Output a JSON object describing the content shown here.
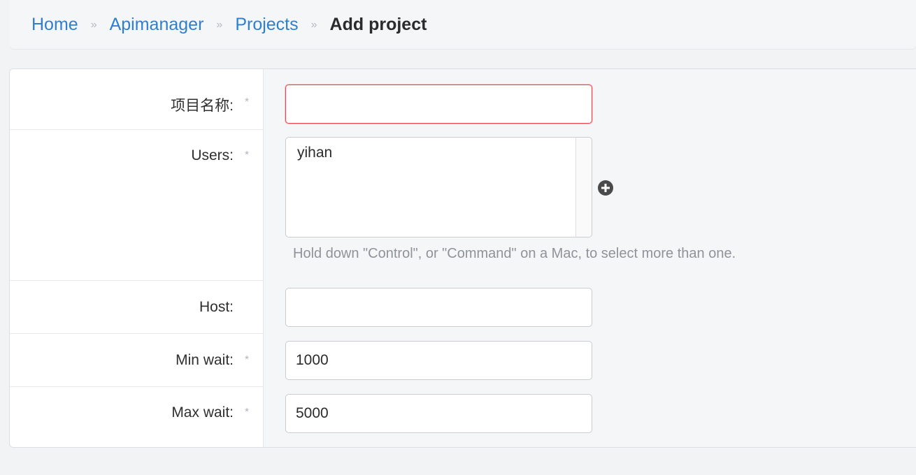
{
  "breadcrumb": {
    "home": "Home",
    "app": "Apimanager",
    "model": "Projects",
    "current": "Add project",
    "separator": "»"
  },
  "form": {
    "name": {
      "label": "项目名称:",
      "required": "*",
      "value": ""
    },
    "users": {
      "label": "Users:",
      "required": "*",
      "options": [
        "yihan"
      ],
      "help": "Hold down \"Control\", or \"Command\" on a Mac, to select more than one."
    },
    "host": {
      "label": "Host:",
      "value": ""
    },
    "min_wait": {
      "label": "Min wait:",
      "required": "*",
      "value": "1000"
    },
    "max_wait": {
      "label": "Max wait:",
      "required": "*",
      "value": "5000"
    }
  },
  "colors": {
    "link": "#2f7fd1",
    "error_border": "#e8474c",
    "help_text": "#8e939a"
  },
  "icons": {
    "add_user": "plus-circle-icon"
  }
}
